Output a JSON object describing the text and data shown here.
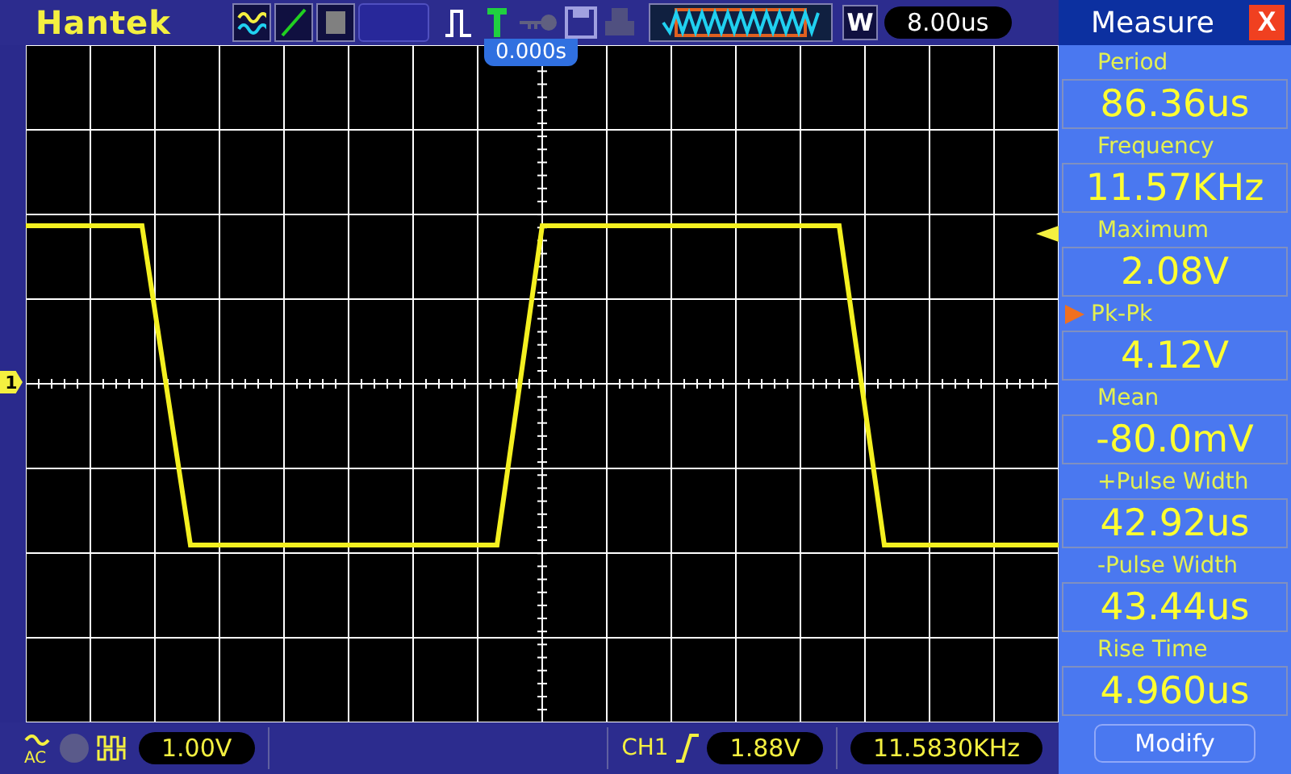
{
  "brand": "Hantek",
  "timebase": {
    "mode": "W",
    "value": "8.00us"
  },
  "scope": {
    "trigger_position": "0.000s",
    "channel_marker": "1"
  },
  "bottom_bar": {
    "coupling": "AC",
    "channel_scale": "1.00V",
    "trigger_source": "CH1",
    "trigger_level": "1.88V",
    "frequency": "11.5830KHz"
  },
  "measure_panel": {
    "title": "Measure",
    "close": "X",
    "items": [
      {
        "label": "Period",
        "value": "86.36us",
        "selected": false
      },
      {
        "label": "Frequency",
        "value": "11.57KHz",
        "selected": false
      },
      {
        "label": "Maximum",
        "value": "2.08V",
        "selected": false
      },
      {
        "label": "Pk-Pk",
        "value": "4.12V",
        "selected": true
      },
      {
        "label": "Mean",
        "value": "-80.0mV",
        "selected": false
      },
      {
        "label": "+Pulse Width",
        "value": "42.92us",
        "selected": false
      },
      {
        "label": "-Pulse Width",
        "value": "43.44us",
        "selected": false
      },
      {
        "label": "Rise Time",
        "value": "4.960us",
        "selected": false
      }
    ],
    "button": "Modify"
  }
}
